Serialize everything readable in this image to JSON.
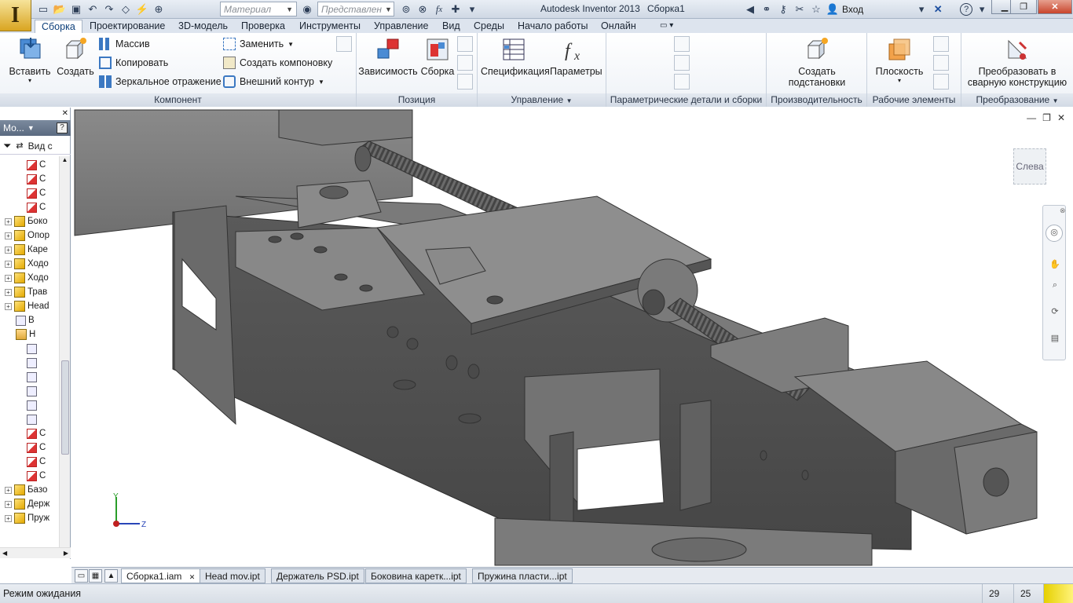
{
  "window": {
    "app_title": "Autodesk Inventor 2013",
    "doc_title": "Сборка1"
  },
  "quick_access": {
    "material_placeholder": "Материал",
    "representation_placeholder": "Представлен",
    "signin_label": "Вход"
  },
  "tabs": [
    "Сборка",
    "Проектирование",
    "3D-модель",
    "Проверка",
    "Инструменты",
    "Управление",
    "Вид",
    "Среды",
    "Начало работы",
    "Онлайн"
  ],
  "ribbon": {
    "component": {
      "title": "Компонент",
      "insert": "Вставить",
      "create": "Создать",
      "pattern": "Массив",
      "copy": "Копировать",
      "mirror": "Зеркальное отражение",
      "replace": "Заменить",
      "create_layout": "Создать компоновку",
      "shrinkwrap": "Внешний контур"
    },
    "position": {
      "title": "Позиция",
      "constrain": "Зависимость",
      "assemble": "Сборка"
    },
    "manage": {
      "title": "Управление",
      "bom": "Спецификация",
      "params": "Параметры"
    },
    "ipart": {
      "title": "Параметрические детали и сборки"
    },
    "productivity": {
      "title": "Производительность",
      "create_sub_1": "Создать",
      "create_sub_2": "подстановки"
    },
    "work_features": {
      "title": "Рабочие элементы",
      "plane": "Плоскость"
    },
    "convert": {
      "title": "Преобразование",
      "weldment_1": "Преобразовать в",
      "weldment_2": "сварную конструкцию"
    }
  },
  "browser": {
    "header": "Мо...",
    "view_label": "Вид с",
    "tree": [
      {
        "label": "С",
        "kind": "constraint-icon",
        "indent": 2
      },
      {
        "label": "С",
        "kind": "constraint-icon",
        "indent": 2
      },
      {
        "label": "С",
        "kind": "constraint-icon",
        "indent": 2
      },
      {
        "label": "С",
        "kind": "constraint-icon",
        "indent": 2
      },
      {
        "label": "Боко",
        "kind": "assembly-icon",
        "indent": 0
      },
      {
        "label": "Опор",
        "kind": "assembly-icon",
        "indent": 0
      },
      {
        "label": "Каре",
        "kind": "assembly-icon",
        "indent": 0
      },
      {
        "label": "Ходо",
        "kind": "assembly-icon",
        "indent": 0
      },
      {
        "label": "Ходо",
        "kind": "assembly-icon",
        "indent": 0
      },
      {
        "label": "Трав",
        "kind": "assembly-icon",
        "indent": 0
      },
      {
        "label": "Head",
        "kind": "assembly-icon",
        "indent": 0
      },
      {
        "label": "В",
        "kind": "part-icon",
        "indent": 1
      },
      {
        "label": "Н",
        "kind": "folder-icon",
        "indent": 1
      },
      {
        "label": "",
        "kind": "part-icon",
        "indent": 2
      },
      {
        "label": "",
        "kind": "part-icon",
        "indent": 2
      },
      {
        "label": "",
        "kind": "part-icon",
        "indent": 2
      },
      {
        "label": "",
        "kind": "part-icon",
        "indent": 2
      },
      {
        "label": "",
        "kind": "part-icon",
        "indent": 2
      },
      {
        "label": "",
        "kind": "part-icon",
        "indent": 2
      },
      {
        "label": "С",
        "kind": "constraint-icon",
        "indent": 2
      },
      {
        "label": "С",
        "kind": "constraint-icon",
        "indent": 2
      },
      {
        "label": "С",
        "kind": "constraint-icon",
        "indent": 2
      },
      {
        "label": "С",
        "kind": "constraint-icon",
        "indent": 2
      },
      {
        "label": "Базо",
        "kind": "assembly-icon",
        "indent": 0
      },
      {
        "label": "Держ",
        "kind": "assembly-icon",
        "indent": 0
      },
      {
        "label": "Пруж",
        "kind": "assembly-icon",
        "indent": 0
      }
    ]
  },
  "viewport": {
    "viewcube_label": "Слева",
    "axis_y": "Y",
    "axis_z": "Z"
  },
  "doc_tabs": [
    "Сборка1.iam",
    "Head mov.ipt",
    "Держатель PSD.ipt",
    "Боковина каретк...ipt",
    "Пружина пласти...ipt"
  ],
  "status": {
    "text": "Режим ожидания",
    "count1": "29",
    "count2": "25"
  },
  "colors": {
    "model_gray": "#6f6f6f",
    "accent_blue": "#0d3f7a",
    "app_gold": "#d9a521"
  }
}
